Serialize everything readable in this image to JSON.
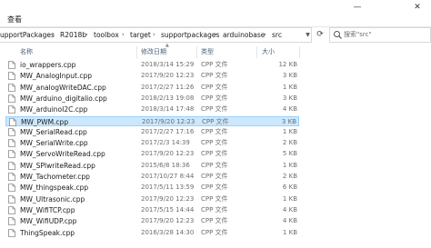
{
  "window": {
    "minimize_glyph": "—",
    "close_glyph": "✕"
  },
  "menu": {
    "view_label": "查看"
  },
  "breadcrumb": [
    "upportPackages",
    "R2018b",
    "toolbox",
    "target",
    "supportpackages",
    "arduinobase",
    "src"
  ],
  "search": {
    "placeholder": "搜索\"src\""
  },
  "columns": {
    "name": "名称",
    "date": "修改日期",
    "type": "类型",
    "size": "大小"
  },
  "files": [
    {
      "name": "io_wrappers.cpp",
      "date": "2018/3/14 15:29",
      "type": "CPP 文件",
      "size": "12 KB",
      "selected": false
    },
    {
      "name": "MW_AnalogInput.cpp",
      "date": "2017/9/20 12:23",
      "type": "CPP 文件",
      "size": "3 KB",
      "selected": false
    },
    {
      "name": "MW_analogWriteDAC.cpp",
      "date": "2017/2/27 11:26",
      "type": "CPP 文件",
      "size": "1 KB",
      "selected": false
    },
    {
      "name": "MW_arduino_digitalio.cpp",
      "date": "2018/2/13 19:08",
      "type": "CPP 文件",
      "size": "3 KB",
      "selected": false
    },
    {
      "name": "MW_arduinoI2C.cpp",
      "date": "2018/3/14 17:48",
      "type": "CPP 文件",
      "size": "4 KB",
      "selected": false
    },
    {
      "name": "MW_PWM.cpp",
      "date": "2017/9/20 12:23",
      "type": "CPP 文件",
      "size": "3 KB",
      "selected": true
    },
    {
      "name": "MW_SerialRead.cpp",
      "date": "2017/2/27 17:16",
      "type": "CPP 文件",
      "size": "1 KB",
      "selected": false
    },
    {
      "name": "MW_SerialWrite.cpp",
      "date": "2017/2/3 14:39",
      "type": "CPP 文件",
      "size": "2 KB",
      "selected": false
    },
    {
      "name": "MW_ServoWriteRead.cpp",
      "date": "2017/9/20 12:23",
      "type": "CPP 文件",
      "size": "5 KB",
      "selected": false
    },
    {
      "name": "MW_SPIwriteRead.cpp",
      "date": "2015/6/8 18:36",
      "type": "CPP 文件",
      "size": "1 KB",
      "selected": false
    },
    {
      "name": "MW_Tachometer.cpp",
      "date": "2017/10/27 8:44",
      "type": "CPP 文件",
      "size": "2 KB",
      "selected": false
    },
    {
      "name": "MW_thingspeak.cpp",
      "date": "2017/5/11 13:59",
      "type": "CPP 文件",
      "size": "6 KB",
      "selected": false
    },
    {
      "name": "MW_Ultrasonic.cpp",
      "date": "2017/9/20 12:23",
      "type": "CPP 文件",
      "size": "1 KB",
      "selected": false
    },
    {
      "name": "MW_WifiTCP.cpp",
      "date": "2017/5/15 14:44",
      "type": "CPP 文件",
      "size": "4 KB",
      "selected": false
    },
    {
      "name": "MW_WifiUDP.cpp",
      "date": "2017/9/20 12:23",
      "type": "CPP 文件",
      "size": "4 KB",
      "selected": false
    },
    {
      "name": "ThingSpeak.cpp",
      "date": "2016/3/28 14:30",
      "type": "CPP 文件",
      "size": "1 KB",
      "selected": false
    }
  ],
  "colors": {
    "selection_fill": "#cce8ff",
    "selection_border": "#99d1ff",
    "header_text": "#4c607a"
  },
  "icons": {
    "file": "cpp-file-icon",
    "search": "search-icon",
    "refresh": "refresh-icon"
  }
}
